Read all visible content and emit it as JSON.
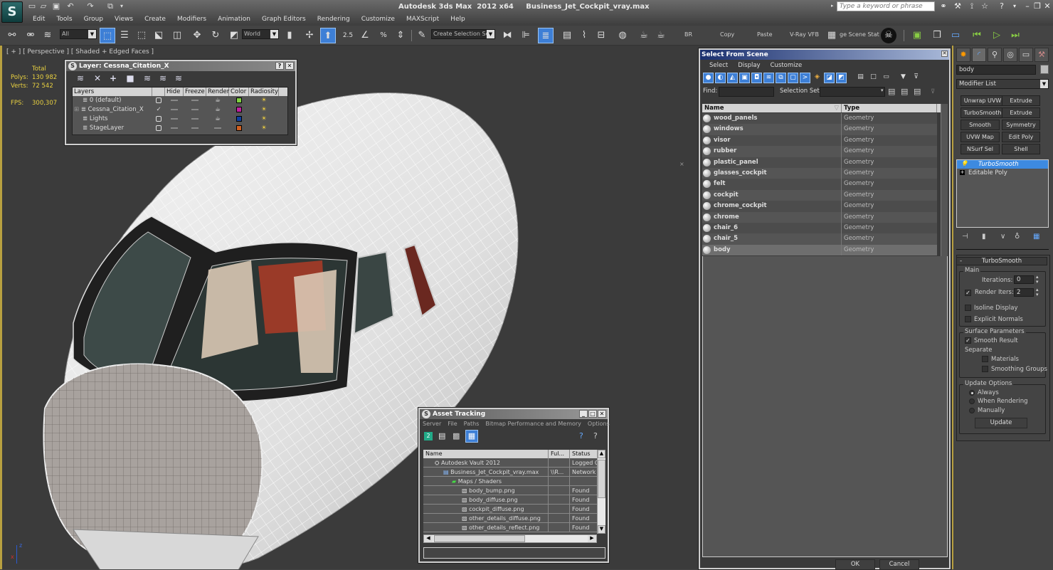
{
  "app": {
    "title": "Autodesk 3ds Max  2012 x64",
    "filename": "Business_Jet_Cockpit_vray.max",
    "logo_glyph": "S",
    "search_placeholder": "Type a keyword or phrase",
    "menus": [
      "Edit",
      "Tools",
      "Group",
      "Views",
      "Create",
      "Modifiers",
      "Animation",
      "Graph Editors",
      "Rendering",
      "Customize",
      "MAXScript",
      "Help"
    ]
  },
  "toolbar": {
    "selection_filter": "All",
    "reference_coord": "World",
    "snap_angle_label": "2.5",
    "named_selection_placeholder": "Create Selection Se",
    "text_buttons": {
      "br": "BR",
      "copy": "Copy",
      "paste": "Paste",
      "vray_vfb": "V-Ray VFB",
      "scene_states": "ge Scene Stat"
    }
  },
  "viewport": {
    "label": "[ + ] [ Perspective ] [ Shaded + Edged Faces ]",
    "stats": {
      "header": "Total",
      "polys_label": "Polys:",
      "polys": "130 982",
      "verts_label": "Verts:",
      "verts": "72 542",
      "fps_label": "FPS:",
      "fps": "300,307"
    },
    "axis": {
      "x": "x",
      "z": "z"
    }
  },
  "layer_window": {
    "title": "Layer: Cessna_Citation_X",
    "columns": [
      "Layers",
      "",
      "Hide",
      "Freeze",
      "Render",
      "Color",
      "Radiosity"
    ],
    "layers": [
      {
        "name": "0 (default)",
        "current": false,
        "render": true,
        "color": "#7fd040"
      },
      {
        "name": "Cessna_Citation_X",
        "current": true,
        "render": true,
        "color": "#c020a0",
        "expandable": true
      },
      {
        "name": "Lights",
        "current": false,
        "render": true,
        "color": "#1040a0"
      },
      {
        "name": "StageLayer",
        "current": false,
        "render": false,
        "color": "#d06020"
      }
    ]
  },
  "select_from_scene": {
    "title": "Select From Scene",
    "menus": [
      "Select",
      "Display",
      "Customize"
    ],
    "find_label": "Find:",
    "find_value": "",
    "selection_set_label": "Selection Set:",
    "selection_set_value": "",
    "columns": {
      "name": "Name",
      "type": "Type"
    },
    "objects": [
      {
        "name": "wood_panels",
        "type": "Geometry"
      },
      {
        "name": "windows",
        "type": "Geometry"
      },
      {
        "name": "visor",
        "type": "Geometry"
      },
      {
        "name": "rubber",
        "type": "Geometry"
      },
      {
        "name": "plastic_panel",
        "type": "Geometry"
      },
      {
        "name": "glasses_cockpit",
        "type": "Geometry"
      },
      {
        "name": "felt",
        "type": "Geometry"
      },
      {
        "name": "cockpit",
        "type": "Geometry"
      },
      {
        "name": "chrome_cockpit",
        "type": "Geometry"
      },
      {
        "name": "chrome",
        "type": "Geometry"
      },
      {
        "name": "chair_6",
        "type": "Geometry"
      },
      {
        "name": "chair_5",
        "type": "Geometry"
      },
      {
        "name": "body",
        "type": "Geometry",
        "selected": true
      }
    ],
    "ok_label": "OK",
    "cancel_label": "Cancel"
  },
  "command_panel": {
    "object_name": "body",
    "modifier_list_label": "Modifier List",
    "modifier_buttons": [
      "Unwrap UVW",
      "Extrude",
      "TurboSmooth",
      "Extrude",
      "Smooth",
      "Symmetry",
      "UVW Map",
      "Edit Poly",
      "NSurf Sel",
      "Shell"
    ],
    "stack": [
      {
        "name": "TurboSmooth",
        "selected": true
      },
      {
        "name": "Editable Poly",
        "selected": false
      }
    ],
    "rollout": {
      "title": "TurboSmooth",
      "main_label": "Main",
      "iterations_label": "Iterations:",
      "iterations": "0",
      "render_iters_label": "Render Iters:",
      "render_iters": "2",
      "render_iters_checked": true,
      "isoline_label": "Isoline Display",
      "isoline_checked": false,
      "explicit_normals_label": "Explicit Normals",
      "explicit_normals_checked": false,
      "surface_label": "Surface Parameters",
      "smooth_result_label": "Smooth Result",
      "smooth_result_checked": true,
      "separate_label": "Separate",
      "materials_label": "Materials",
      "smoothing_groups_label": "Smoothing Groups",
      "update_options_label": "Update Options",
      "update_options": [
        "Always",
        "When Rendering",
        "Manually"
      ],
      "update_selected": "Always",
      "update_button": "Update"
    }
  },
  "asset_tracking": {
    "title": "Asset Tracking",
    "menus": [
      "Server",
      "File",
      "Paths",
      "Bitmap Performance and Memory",
      "Options"
    ],
    "columns": [
      "Name",
      "Ful...",
      "Status"
    ],
    "rows": [
      {
        "name": "Autodesk Vault 2012",
        "full": "",
        "status": "Logged O",
        "indent": 1
      },
      {
        "name": "Business_Jet_Cockpit_vray.max",
        "full": "\\\\R...",
        "status": "Network I",
        "indent": 2
      },
      {
        "name": "Maps / Shaders",
        "full": "",
        "status": "",
        "indent": 3
      },
      {
        "name": "body_bump.png",
        "full": "",
        "status": "Found",
        "indent": 4
      },
      {
        "name": "body_diffuse.png",
        "full": "",
        "status": "Found",
        "indent": 4
      },
      {
        "name": "cockpit_diffuse.png",
        "full": "",
        "status": "Found",
        "indent": 4
      },
      {
        "name": "other_details_diffuse.png",
        "full": "",
        "status": "Found",
        "indent": 4
      },
      {
        "name": "other_details_reflect.png",
        "full": "",
        "status": "Found",
        "indent": 4
      }
    ]
  }
}
